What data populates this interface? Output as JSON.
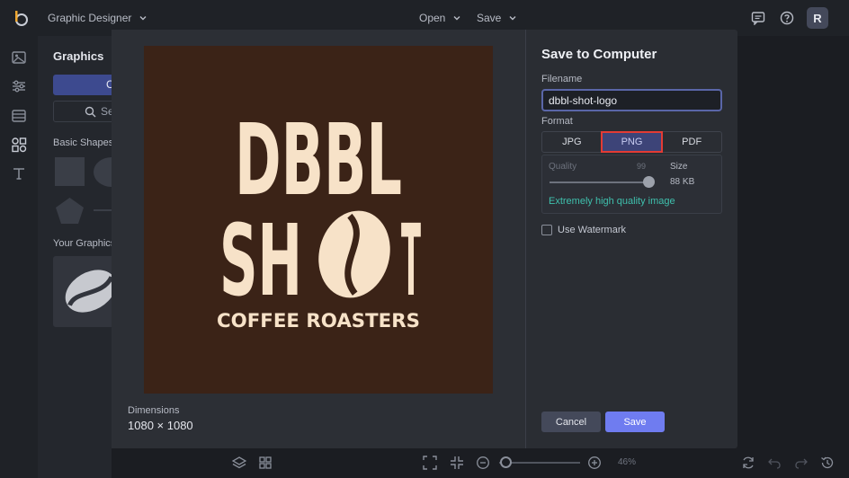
{
  "app": {
    "name": "Graphic Designer",
    "menu_open": "Open",
    "menu_save": "Save",
    "avatar_initial": "R"
  },
  "sidebar": {
    "title": "Graphics",
    "primary_button": "C",
    "search_partial": "Se",
    "section_basic": "Basic Shapes",
    "section_yours": "Your Graphics"
  },
  "bottombar": {
    "zoom_level": "46%"
  },
  "dialog": {
    "title": "Save to Computer",
    "filename_label": "Filename",
    "filename_value": "dbbl-shot-logo",
    "format_label": "Format",
    "formats": [
      "JPG",
      "PNG",
      "PDF"
    ],
    "selected_format": "PNG",
    "quality_label": "Quality",
    "quality_value": "99",
    "size_label": "Size",
    "size_value": "88 KB",
    "quality_description": "Extremely high quality image",
    "watermark_label": "Use Watermark",
    "dimensions_label": "Dimensions",
    "dimensions_value": "1080 × 1080",
    "cancel_label": "Cancel",
    "save_label": "Save"
  },
  "preview_logo": {
    "line1": "DBBL",
    "line2_left": "SH",
    "line2_right": "T",
    "tagline": "COFFEE ROASTERS"
  },
  "colors": {
    "accent": "#6f7cf0",
    "logo_bg": "#3b2317",
    "logo_fg": "#f7e2c8",
    "quality_text": "#3fc0ad",
    "highlight_outline": "#e33b34"
  }
}
